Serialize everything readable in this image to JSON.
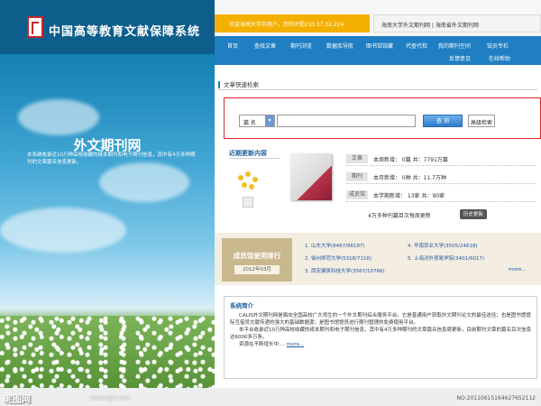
{
  "header": {
    "system_title": "中国高等教育文献保障系统",
    "welcome_text": "欢迎海南大学的用户，您的IP是210.37.32.224",
    "login_text": "海南大学外文期刊网 | 海南省外文期刊网"
  },
  "nav": {
    "row1": [
      "首页",
      "查找文章",
      "期刊浏览",
      "数据库导航",
      "图书馆馆藏",
      "代查代检",
      "我的期刊空间",
      "馆员专栏"
    ],
    "row2": [
      "反馈意见",
      "在线帮助"
    ]
  },
  "hero": {
    "title": "外文期刊网",
    "desc": "本系统收录近10万种高校收藏的纸本期刊和电子期刊信息，其中有4万多种期刊的文章篇名信息更新。"
  },
  "search": {
    "section_title": "文章快速检索",
    "field_value": "篇 名",
    "button_label": "查 询",
    "advanced_label": "高级检索"
  },
  "recent": {
    "title": "近期更新内容",
    "stats": [
      {
        "tag": "文章",
        "text": "本周新增： 0篇  共：7791万篇"
      },
      {
        "tag": "期刊",
        "text": "本月新增： 0种  共：11.7万种"
      },
      {
        "tag": "成员馆",
        "text": "本学期新增： 13家  共：90家"
      }
    ],
    "history_note": "4万多种刊篇目次每周更新",
    "history_button": "历史更新"
  },
  "ranking": {
    "title": "成员馆使用排行",
    "period": "2012年03月",
    "items": [
      "1. 山东大学(8467/88187)",
      "4. 华南农业大学(3505/24618)",
      "2. 徐州师范大学(5318/7116)",
      "5. 上海对外贸易学院(3401/6017)",
      "3. 西安建筑科技大学(3567/10766)",
      "more..."
    ]
  },
  "intro": {
    "title": "系统简介",
    "p1": "CALIS外文期刊网是面向全国高校广大师生的一个外文期刊综合服务平台。它是普通用户获取外文期刊论文的最佳途径；也是图书馆馆际互借员文献传递的强大的基础数据源；是图书馆馆员进行期刊管理的免费使用平台。",
    "p2": "本平台收录近10万种高校收藏的纸本期刊和电子期刊信息，其中有4万多种期刊的文章篇名信息周更新，目前期刊文章的篇名目次信息达6000多万条。",
    "p3": "资源在不断增长中....",
    "more": "more..."
  },
  "watermark": {
    "left": "昵图网",
    "url": "www.nipic.com",
    "id": "NO:20110615164627652112"
  },
  "colors": {
    "nav_blue": "#1f7fc2",
    "welcome_orange": "#f4b000",
    "highlight_red": "#d9252a"
  }
}
